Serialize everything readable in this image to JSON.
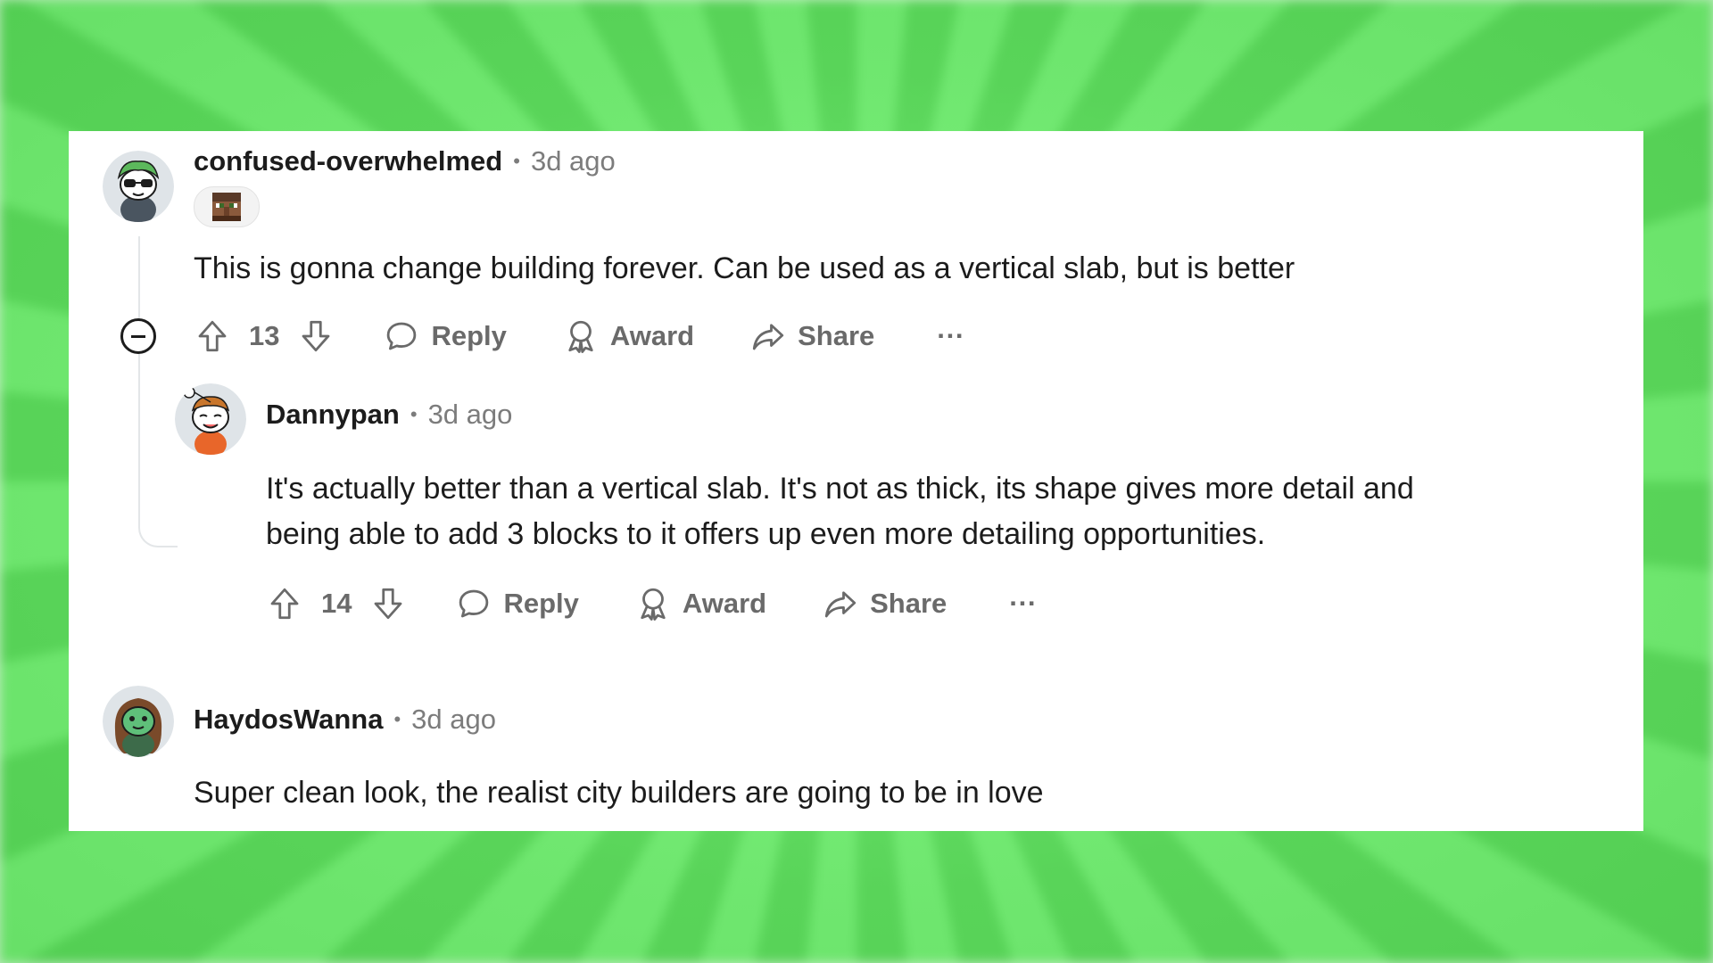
{
  "comments": [
    {
      "username": "confused-overwhelmed",
      "separator": "•",
      "time": "3d ago",
      "avatar_icon": "snoo-avatar-green-hair-icon",
      "flair_icon": "minecraft-villager-flair-icon",
      "body": "This is gonna change building forever. Can be used as a vertical slab, but is better",
      "votes": "13",
      "reply_label": "Reply",
      "award_label": "Award",
      "share_label": "Share",
      "more_label": "···"
    },
    {
      "username": "Dannypan",
      "separator": "•",
      "time": "3d ago",
      "avatar_icon": "snoo-avatar-orange-icon",
      "body_line1": "It's actually better than a vertical slab. It's not as thick, its shape gives more detail and",
      "body_line2": "being able to add 3 blocks to it offers up even more detailing opportunities.",
      "votes": "14",
      "reply_label": "Reply",
      "award_label": "Award",
      "share_label": "Share",
      "more_label": "···"
    },
    {
      "username": "HaydosWanna",
      "separator": "•",
      "time": "3d ago",
      "avatar_icon": "snoo-avatar-green-face-icon",
      "body": "Super clean look, the realist city builders are going to be in love"
    }
  ],
  "colors": {
    "background_green": "#6fe86f",
    "card_background": "#ffffff",
    "text_primary": "#1c1c1c",
    "text_secondary": "#7c7c7c"
  }
}
